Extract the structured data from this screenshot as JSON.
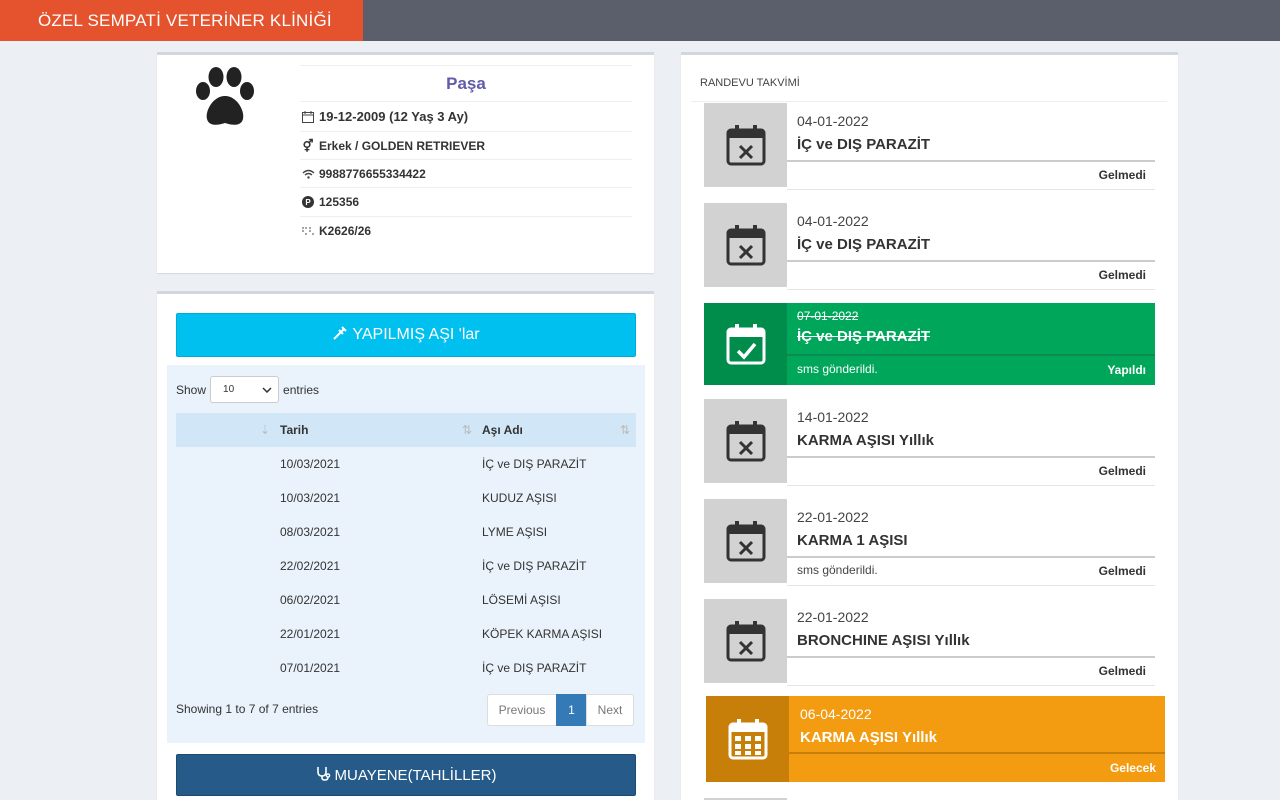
{
  "header": {
    "brand": "ÖZEL SEMPATİ VETERİNER KLİNİĞİ"
  },
  "pet": {
    "name": "Paşa",
    "birth": "19-12-2009 (12 Yaş 3 Ay)",
    "gender_breed": "Erkek / GOLDEN RETRIEVER",
    "chip": "9988776655334422",
    "parking": "125356",
    "code": "K2626/26",
    "icons": [
      "paw-icon",
      "calendar-icon",
      "gender-icon",
      "wifi-icon",
      "p-circle-icon",
      "braille-icon"
    ]
  },
  "vaccines": {
    "button_label": "YAPILMIŞ AŞI 'lar",
    "show_label": "Show",
    "entries_label": "entries",
    "page_size": "10",
    "columns": [
      "",
      "Tarih",
      "Aşı Adı"
    ],
    "rows": [
      {
        "date": "10/03/2021",
        "name": "İÇ ve DIŞ PARAZİT"
      },
      {
        "date": "10/03/2021",
        "name": "KUDUZ AŞISI"
      },
      {
        "date": "08/03/2021",
        "name": "LYME AŞISI"
      },
      {
        "date": "22/02/2021",
        "name": "İÇ ve DIŞ PARAZİT"
      },
      {
        "date": "06/02/2021",
        "name": "LÖSEMİ AŞISI"
      },
      {
        "date": "22/01/2021",
        "name": "KÖPEK KARMA AŞISI"
      },
      {
        "date": "07/01/2021",
        "name": "İÇ ve DIŞ PARAZİT"
      }
    ],
    "info": "Showing 1 to 7 of 7 entries",
    "pager": {
      "previous": "Previous",
      "current": "1",
      "next": "Next"
    },
    "exam_button": "MUAYENE(TAHLİLLER)"
  },
  "appointments": {
    "title": "RANDEVU TAKVİMİ",
    "items": [
      {
        "date": "04-01-2022",
        "name": "İÇ ve DIŞ PARAZİT",
        "note": "",
        "status": "Gelmedi",
        "state": "missed"
      },
      {
        "date": "04-01-2022",
        "name": "İÇ ve DIŞ PARAZİT",
        "note": "",
        "status": "Gelmedi",
        "state": "missed"
      },
      {
        "date": "07-01-2022",
        "name": "İÇ ve DIŞ PARAZİT",
        "note": "sms gönderildi.",
        "status": "Yapıldı",
        "state": "done"
      },
      {
        "date": "14-01-2022",
        "name": "KARMA AŞISI Yıllık",
        "note": "",
        "status": "Gelmedi",
        "state": "missed"
      },
      {
        "date": "22-01-2022",
        "name": "KARMA 1 AŞISI",
        "note": "sms gönderildi.",
        "status": "Gelmedi",
        "state": "missed"
      },
      {
        "date": "22-01-2022",
        "name": "BRONCHINE AŞISI Yıllık",
        "note": "",
        "status": "Gelmedi",
        "state": "missed"
      },
      {
        "date": "06-04-2022",
        "name": "KARMA AŞISI Yıllık",
        "note": "",
        "status": "Gelecek",
        "state": "future"
      }
    ]
  },
  "colors": {
    "brand": "#e4532d",
    "topbar": "#5a5f6b",
    "info_button": "#00c0ef",
    "exam_button": "#265a88",
    "done": "#00a65a",
    "future": "#f39c12",
    "missed_icon_bg": "#d2d2d2"
  }
}
